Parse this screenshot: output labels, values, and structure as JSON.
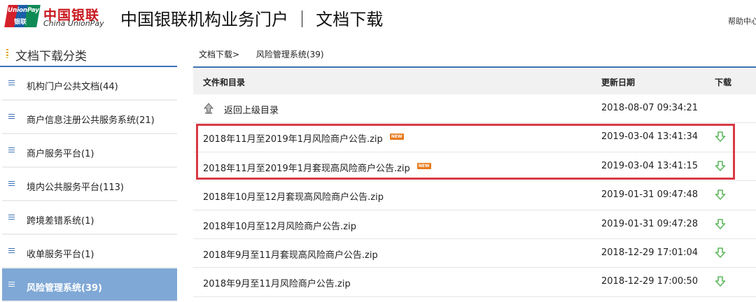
{
  "header": {
    "logo_line1": "UnionPay",
    "logo_line2": "银联",
    "brand_cn": "中国银联",
    "brand_en": "China UnionPay",
    "portal_title": "中国银联机构业务门户 ｜ 文档下载",
    "help_text": "帮助中心"
  },
  "sidebar": {
    "title": "文档下载分类",
    "items": [
      {
        "label": "机构门户公共文档(44)"
      },
      {
        "label": "商户信息注册公共服务系统(21)"
      },
      {
        "label": "商户服务平台(1)"
      },
      {
        "label": "境内公共服务平台(113)"
      },
      {
        "label": "跨境差错系统(1)"
      },
      {
        "label": "收单服务平台(1)"
      },
      {
        "label": "风险管理系统(39)"
      }
    ]
  },
  "breadcrumb": {
    "root": "文档下载>",
    "current": "风险管理系统(39)"
  },
  "table": {
    "headers": {
      "name": "文件和目录",
      "date": "更新日期",
      "download": "下载"
    },
    "back_row": {
      "label": "返回上级目录",
      "date": "2018-08-07 09:34:21"
    },
    "new_badge": "NEW",
    "rows": [
      {
        "name": "2018年11月至2019年1月风险商户公告.zip",
        "date": "2019-03-04 13:41:34",
        "is_new": true
      },
      {
        "name": "2018年11月至2019年1月套现高风险商户公告.zip",
        "date": "2019-03-04 13:41:15",
        "is_new": true
      },
      {
        "name": "2018年10月至12月套现高风险商户公告.zip",
        "date": "2019-01-31 09:47:48",
        "is_new": false
      },
      {
        "name": "2018年10月至12月风险商户公告.zip",
        "date": "2019-01-31 09:47:28",
        "is_new": false
      },
      {
        "name": "2018年9月至11月套现高风险商户公告.zip",
        "date": "2018-12-29 17:01:04",
        "is_new": false
      },
      {
        "name": "2018年9月至11月风险商户公告.zip",
        "date": "2018-12-29 17:00:50",
        "is_new": false
      }
    ]
  },
  "colors": {
    "accent": "#3c72b8",
    "brand_red": "#c8161d",
    "active_item": "#7fa8d6",
    "highlight_border": "#d83a45",
    "download_icon": "#5cb85c"
  },
  "icons": {
    "back": "up-arrow-icon",
    "download": "download-arrow-icon"
  }
}
